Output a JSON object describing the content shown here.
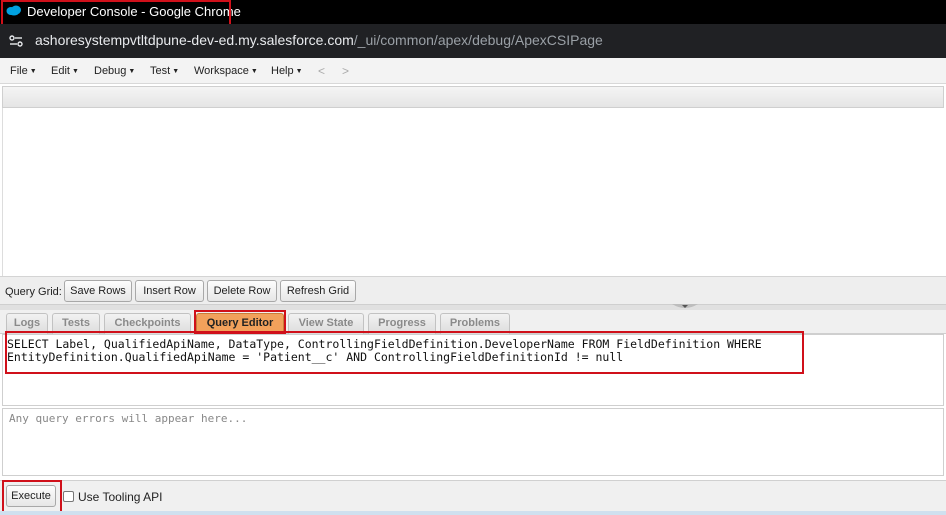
{
  "window": {
    "title": "Developer Console - Google Chrome",
    "favicon": "salesforce-cloud-icon"
  },
  "address_bar": {
    "host": "ashoresystempvtltdpune-dev-ed.my.salesforce.com",
    "path": "/_ui/common/apex/debug/ApexCSIPage",
    "site_icon": "site-settings-icon"
  },
  "menu": {
    "items": [
      "File",
      "Edit",
      "Debug",
      "Test",
      "Workspace",
      "Help"
    ],
    "back": "<",
    "forward": ">"
  },
  "query_grid": {
    "label": "Query Grid:",
    "buttons": [
      "Save Rows",
      "Insert Row",
      "Delete Row",
      "Refresh Grid"
    ]
  },
  "tabs": [
    "Logs",
    "Tests",
    "Checkpoints",
    "Query Editor",
    "View State",
    "Progress",
    "Problems"
  ],
  "active_tab": "Query Editor",
  "query_editor": {
    "query": "SELECT Label, QualifiedApiName, DataType, ControllingFieldDefinition.DeveloperName FROM FieldDefinition WHERE EntityDefinition.QualifiedApiName = 'Patient__c' AND ControllingFieldDefinitionId != null",
    "errors_placeholder": "Any query errors will appear here..."
  },
  "footer": {
    "execute_label": "Execute",
    "tooling_label": "Use Tooling API",
    "tooling_checked": false
  },
  "colors": {
    "highlight_border": "#d0101a",
    "active_tab": "#f2a15b",
    "salesforce_blue": "#00a1e0"
  }
}
